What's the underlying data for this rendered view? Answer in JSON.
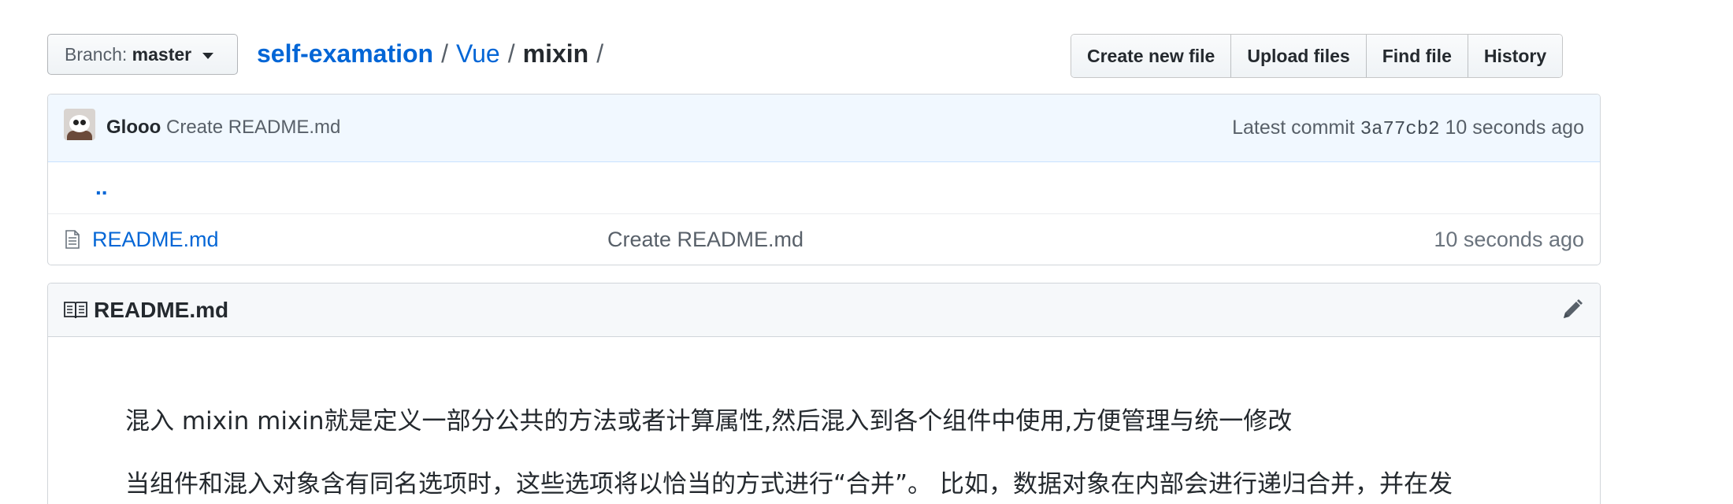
{
  "branch": {
    "label": "Branch:",
    "value": "master"
  },
  "breadcrumb": {
    "root": "self-examation",
    "sep1": "/",
    "folder": "Vue",
    "sep2": "/",
    "current": "mixin",
    "sep3": "/"
  },
  "actions": {
    "create_new_file": "Create new file",
    "upload_files": "Upload files",
    "find_file": "Find file",
    "history": "History"
  },
  "commit": {
    "author": "Glooo",
    "message": "Create README.md",
    "latest_label": "Latest commit",
    "sha": "3a77cb2",
    "age": "10 seconds ago"
  },
  "listing": {
    "parent": "..",
    "files": [
      {
        "name": "README.md",
        "message": "Create README.md",
        "age": "10 seconds ago"
      }
    ]
  },
  "readme": {
    "title": "README.md",
    "paragraphs": [
      "混入 mixin mixin就是定义一部分公共的方法或者计算属性,然后混入到各个组件中使用,方便管理与统一修改",
      "当组件和混入对象含有同名选项时，这些选项将以恰当的方式进行“合并”。 比如，数据对象在内部会进行递归合并，并在发"
    ]
  },
  "icons": {
    "branch_caret": "caret-down-icon",
    "file": "file-icon",
    "book": "book-icon",
    "edit": "pencil-icon"
  }
}
